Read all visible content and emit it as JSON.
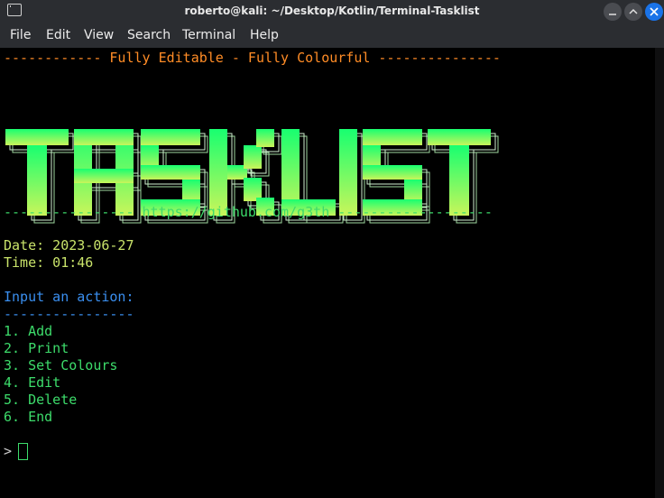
{
  "window": {
    "title": "roberto@kali: ~/Desktop/Kotlin/Terminal-Tasklist"
  },
  "menu": [
    "File",
    "Edit",
    "View",
    "Search",
    "Terminal",
    "Help"
  ],
  "terminal": {
    "header_line": "------------ Fully Editable - Fully Colourful ---------------",
    "banner_text": "TASKLIST",
    "url_line": "---------------- https://github.com/g3th -------------------",
    "date_line": "Date: 2023-06-27",
    "time_line": "Time: 01:46",
    "prompt_label": "Input an action:",
    "prompt_rule": "----------------",
    "options": [
      "1. Add",
      "2. Print",
      "3. Set Colours",
      "4. Edit",
      "5. Delete",
      "6. End"
    ],
    "input_prompt": "> "
  },
  "colors": {
    "header": "#ff8c26",
    "banner_top": "#18ff70",
    "banner_bottom": "#c9f55a",
    "url": "#3ddc6b",
    "datetime": "#c9e36a",
    "prompt": "#3a8ff0",
    "options": "#3ddc6b"
  }
}
